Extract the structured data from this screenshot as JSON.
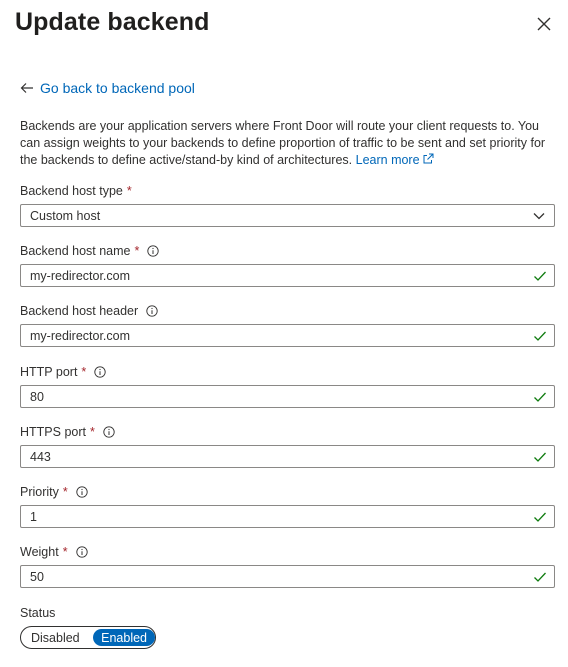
{
  "panel": {
    "title": "Update backend",
    "back_link": "Go back to backend pool",
    "description": "Backends are your application servers where Front Door will route your client requests to. You can assign weights to your backends to define proportion of traffic to be sent and set priority for the backends to define active/stand-by kind of architectures.",
    "learn_more": "Learn more"
  },
  "fields": {
    "host_type": {
      "label": "Backend host type",
      "required": "*",
      "value": "Custom host"
    },
    "host_name": {
      "label": "Backend host name",
      "required": "*",
      "value": "my-redirector.com"
    },
    "host_header": {
      "label": "Backend host header",
      "value": "my-redirector.com"
    },
    "http_port": {
      "label": "HTTP port",
      "required": "*",
      "value": "80"
    },
    "https_port": {
      "label": "HTTPS port",
      "required": "*",
      "value": "443"
    },
    "priority": {
      "label": "Priority",
      "required": "*",
      "value": "1"
    },
    "weight": {
      "label": "Weight",
      "required": "*",
      "value": "50"
    }
  },
  "status": {
    "label": "Status",
    "off_label": "Disabled",
    "on_label": "Enabled",
    "selected": "Enabled"
  },
  "colors": {
    "accent": "#0067b8",
    "required": "#a4262c",
    "valid": "#107c10",
    "border": "#8a8886"
  },
  "icons": {
    "close": "close-icon",
    "back": "arrow-left-icon",
    "external": "external-link-icon",
    "info": "info-icon",
    "valid": "checkmark-icon",
    "dropdown": "chevron-down-icon"
  }
}
